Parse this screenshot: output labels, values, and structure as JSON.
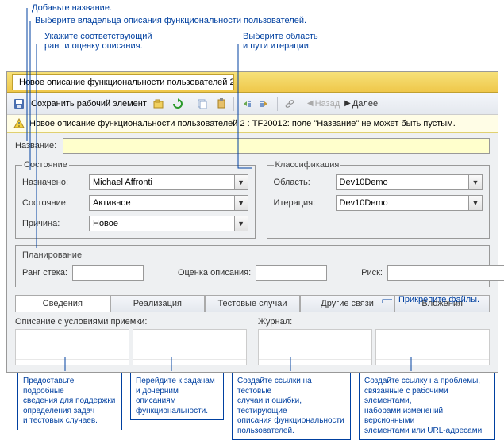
{
  "callouts": {
    "c_title": "Добавьте название.",
    "c_owner": "Выберите владельца описания функциональности пользователей.",
    "c_rank": "Укажите соответствующий\nранг и оценку описания.",
    "c_area": "Выберите область\nи пути итерации.",
    "cb_details": "Предоставьте подробные\nсведения для поддержки\nопределения задач\nи тестовых случаев.",
    "cb_impl": "Перейдите к задачам\nи дочерним описаниям\nфункциональности.",
    "cb_tests": "Создайте ссылки на тестовые\nслучаи и ошибки, тестирующие\nописания функциональности\nпользователей.",
    "cb_links": "Создайте ссылку на проблемы,\nсвязанные с рабочими элементами,\nнаборами изменений, версионными\nэлементами или URL-адресами.",
    "c_attach": "Прикрепите файлы."
  },
  "tab_title": "Новое описание функциональности пользователей 2*",
  "toolbar": {
    "save_label": "Сохранить рабочий элемент",
    "nav_back": "Назад",
    "nav_fwd": "Далее"
  },
  "warning": "Новое описание функциональности пользователей 2 : TF20012: поле \"Название\" не может быть пустым.",
  "labels": {
    "title": "Название:",
    "state_group": "Состояние",
    "assigned": "Назначено:",
    "state": "Состояние:",
    "reason": "Причина:",
    "class_group": "Классификация",
    "area": "Область:",
    "iteration": "Итерация:",
    "planning": "Планирование",
    "rank": "Ранг стека:",
    "estimate": "Оценка описания:",
    "risk": "Риск:"
  },
  "values": {
    "assigned": "Michael Affronti",
    "state": "Активное",
    "reason": "Новое",
    "area": "Dev10Demo",
    "iteration": "Dev10Demo",
    "rank": "",
    "estimate": "",
    "risk": ""
  },
  "tabs2": [
    "Сведения",
    "Реализация",
    "Тестовые случаи",
    "Другие связи",
    "Вложения"
  ],
  "detail_labels": {
    "accept": "Описание с условиями приемки:",
    "journal": "Журнал:"
  }
}
